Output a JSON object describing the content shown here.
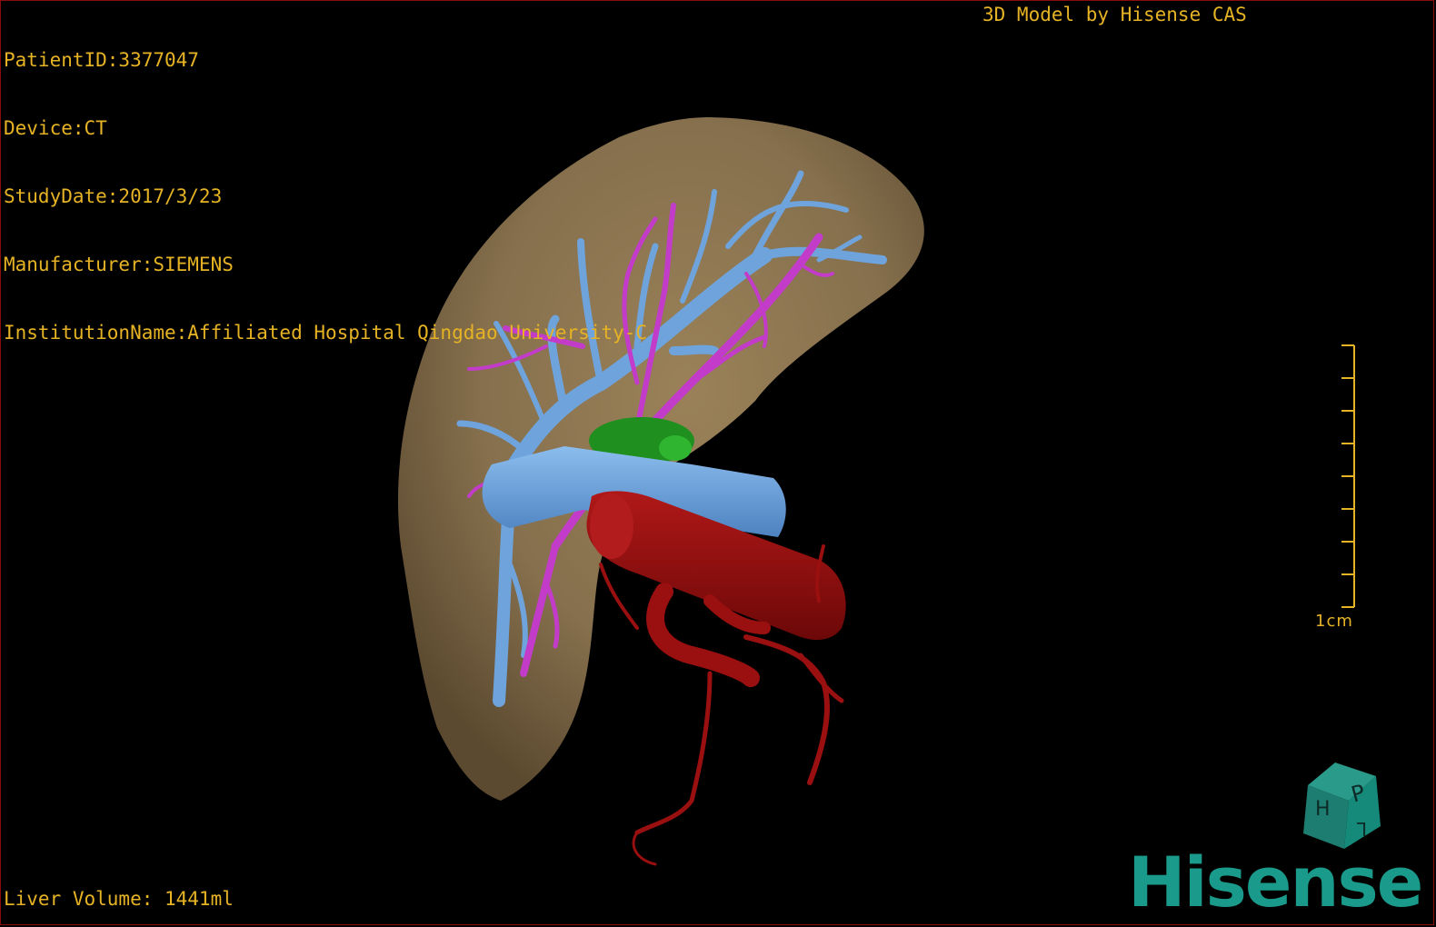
{
  "study": {
    "patient_id": "PatientID:3377047",
    "device": "Device:CT",
    "study_date": "StudyDate:2017/3/23",
    "manufacturer": "Manufacturer:SIEMENS",
    "institution": "InstitutionName:Affiliated Hospital Qingdao University-C"
  },
  "header": {
    "model_credit": "3D Model by Hisense CAS"
  },
  "footer": {
    "liver_volume": "Liver Volume: 1441ml"
  },
  "scale_bar": {
    "label": "1cm",
    "tick_count": 9
  },
  "orientation_cube": {
    "faces": [
      "H",
      "P",
      "L"
    ]
  },
  "brand": {
    "logo_text": "Hisense",
    "logo_color": "#1a9a8a"
  },
  "colors": {
    "overlay_text": "#e6b325",
    "liver": "#8a7350",
    "hepatic_vein": "#6fa3dc",
    "portal_vein": "#c23cc9",
    "artery": "#9a0f0f",
    "gallbladder": "#1f8f1f",
    "border": "#8a0d0d"
  },
  "structures": [
    "liver",
    "hepatic-vein",
    "portal-vein",
    "inferior-vena-cava",
    "aorta",
    "gallbladder",
    "hepatic-artery"
  ]
}
